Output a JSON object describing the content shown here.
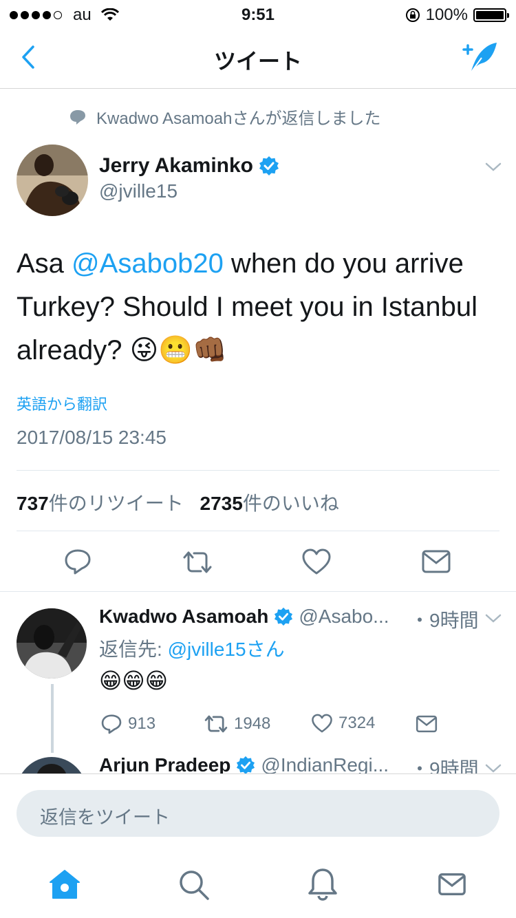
{
  "status_bar": {
    "carrier": "au",
    "time": "9:51",
    "battery": "100%"
  },
  "nav": {
    "title": "ツイート"
  },
  "reply_context": {
    "text": "Kwadwo Asamoahさんが返信しました"
  },
  "tweet": {
    "author_name": "Jerry Akaminko",
    "author_handle": "@jville15",
    "text_before": "Asa ",
    "mention": "@Asabob20",
    "text_after": " when do you arrive Turkey? Should I meet you in Istanbul already? ",
    "emojis": "😜😬👊🏾",
    "translate_label": "英語から翻訳",
    "timestamp": "2017/08/15 23:45",
    "retweet_count": "737",
    "retweet_label": "件のリツイート",
    "like_count": "2735",
    "like_label": "件のいいね"
  },
  "replies": [
    {
      "author_name": "Kwadwo Asamoah",
      "author_handle": "@Asabo...",
      "time": "・9時間",
      "reply_to_label": "返信先: ",
      "reply_to_handle": "@jville15さん",
      "text": "😁😁😁",
      "reply_count": "913",
      "retweet_count": "1948",
      "like_count": "7324"
    },
    {
      "author_name": "Arjun Pradeep",
      "author_handle": "@IndianRegi...",
      "time": "・9時間"
    }
  ],
  "composer": {
    "placeholder": "返信をツイート"
  },
  "colors": {
    "accent": "#1da1f2",
    "secondary_text": "#657786",
    "divider": "#e1e8ed"
  },
  "icons": [
    "back-icon",
    "compose-tweet-icon",
    "speech-bubble-icon",
    "verified-icon",
    "chevron-down-icon",
    "reply-icon",
    "retweet-icon",
    "like-icon",
    "dm-icon",
    "home-icon",
    "search-icon",
    "notifications-icon",
    "messages-icon"
  ]
}
